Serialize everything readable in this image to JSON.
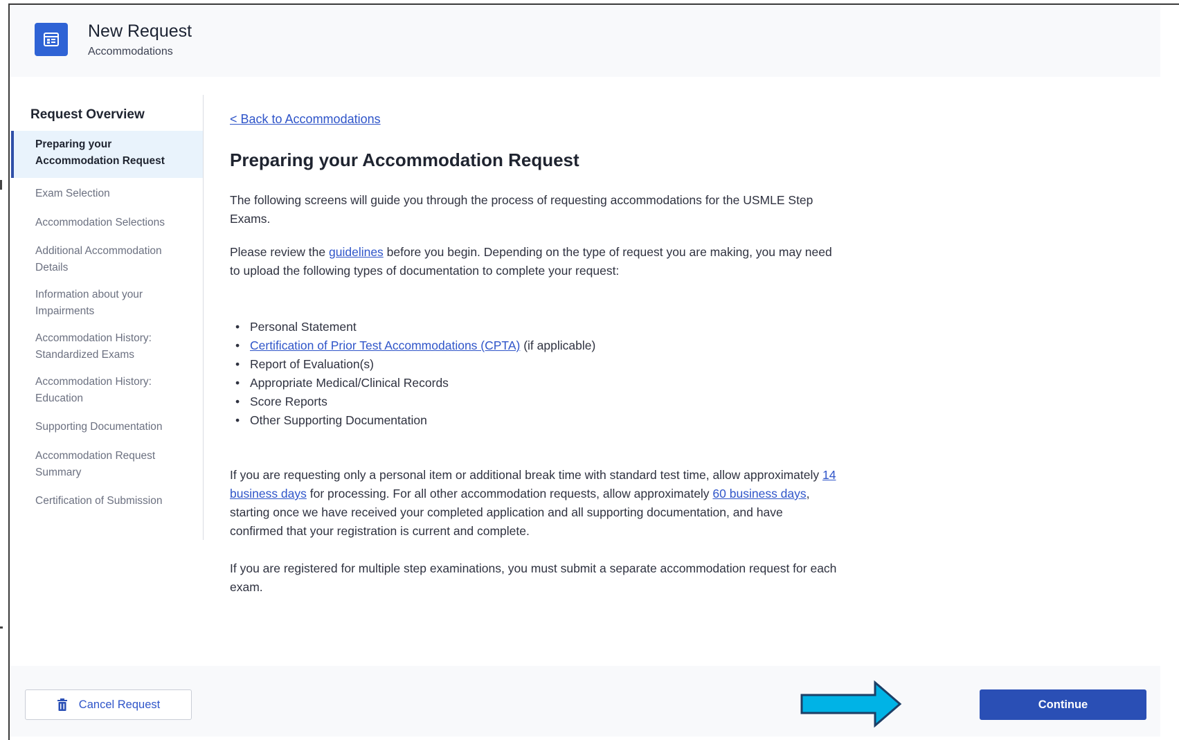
{
  "header": {
    "title": "New Request",
    "subtitle": "Accommodations",
    "icon": "calendar-icon"
  },
  "sidebar": {
    "title": "Request Overview",
    "items": [
      {
        "label": "Preparing your Accommodation Request",
        "active": true
      },
      {
        "label": "Exam Selection"
      },
      {
        "label": "Accommodation Selections"
      },
      {
        "label": "Additional Accommodation Details"
      },
      {
        "label": "Information about your Impairments"
      },
      {
        "label": "Accommodation History: Standardized Exams"
      },
      {
        "label": "Accommodation History: Education"
      },
      {
        "label": "Supporting Documentation"
      },
      {
        "label": "Accommodation Request Summary"
      },
      {
        "label": "Certification of Submission"
      }
    ]
  },
  "main": {
    "back_link": "< Back to Accommodations",
    "title": "Preparing your Accommodation Request",
    "intro": "The following screens will guide you through the process of requesting accommodations for the USMLE Step Exams.",
    "review": {
      "before": "Please review the ",
      "link": "guidelines",
      "after": " before you begin. Depending on the type of request you are making, you may need to upload the following types of documentation to complete your request:"
    },
    "documents": {
      "personal_statement": "Personal Statement",
      "cpta_link": "Certification of Prior Test Accommodations (CPTA)",
      "cpta_suffix": " (if applicable)",
      "evaluation": "Report of Evaluation(s)",
      "medical": "Appropriate Medical/Clinical Records",
      "scores": "Score Reports",
      "other": "Other Supporting Documentation"
    },
    "processing": {
      "part1": "If you are requesting only a personal item or additional break time with standard test time, allow approximately ",
      "link1": "14 business days",
      "part2": " for processing. For all other accommodation requests, allow approximately ",
      "link2": "60 business days",
      "part3": ", starting once we have received your completed application and all supporting documentation, and have confirmed that your registration is current and complete."
    },
    "multiple": "If you are registered for multiple step examinations, you must submit a separate accommodation request for each exam."
  },
  "footer": {
    "cancel_label": "Cancel Request",
    "continue_label": "Continue"
  },
  "colors": {
    "accent": "#2f63d5",
    "primary_button": "#2a4fb5",
    "link": "#2f55c9",
    "active_nav_bg": "#e9f3fc",
    "arrow_fill": "#00b3e6"
  }
}
